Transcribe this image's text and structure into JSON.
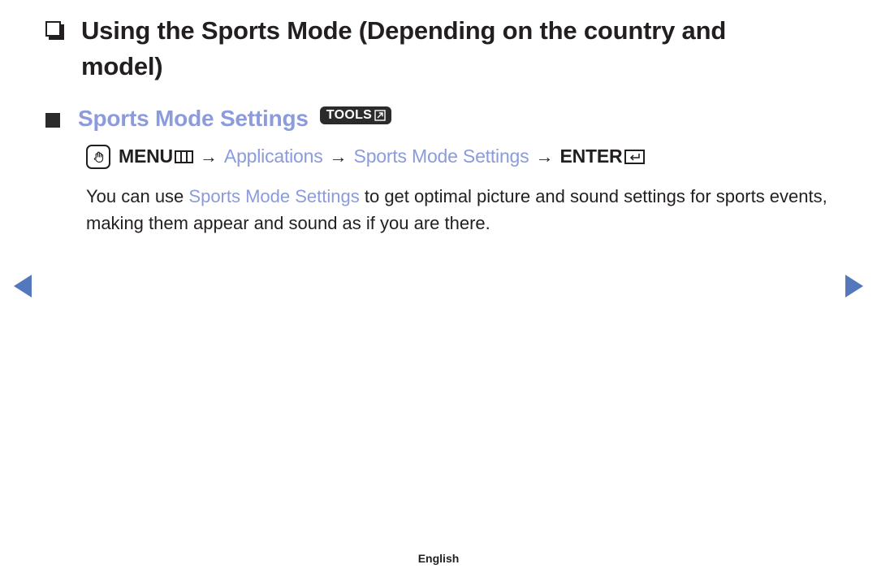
{
  "page": {
    "title": "Using the Sports Mode (Depending on the country and model)",
    "title_bullet_icon": "shadowed-white-square-icon",
    "language_footer": "English"
  },
  "section": {
    "bullet_icon": "filled-square-icon",
    "heading": "Sports Mode Settings",
    "badge": {
      "label": "TOOLS",
      "icon": "diagonal-arrow-box-icon"
    }
  },
  "menu_path": {
    "touch_icon": "pointing-hand-icon",
    "menu_label": "MENU",
    "menu_icon": "menu-columns-icon",
    "arrow1": "→",
    "item_applications": "Applications",
    "arrow2": "→",
    "item_sports_mode_settings": "Sports Mode Settings",
    "arrow3": "→",
    "enter_label": "ENTER",
    "enter_icon": "return-arrow-box-icon"
  },
  "body": {
    "text_part1": "You can use ",
    "highlight": "Sports Mode Settings",
    "text_part2": " to get optimal picture and sound settings for sports events, making them appear and sound as if you are there."
  },
  "navigation": {
    "prev_label": "Previous page",
    "next_label": "Next page"
  },
  "colors": {
    "accent_blue": "#8b9bdb",
    "nav_arrow_blue": "#5478bd",
    "text_dark": "#231f20",
    "badge_dark": "#2b2b2b"
  }
}
